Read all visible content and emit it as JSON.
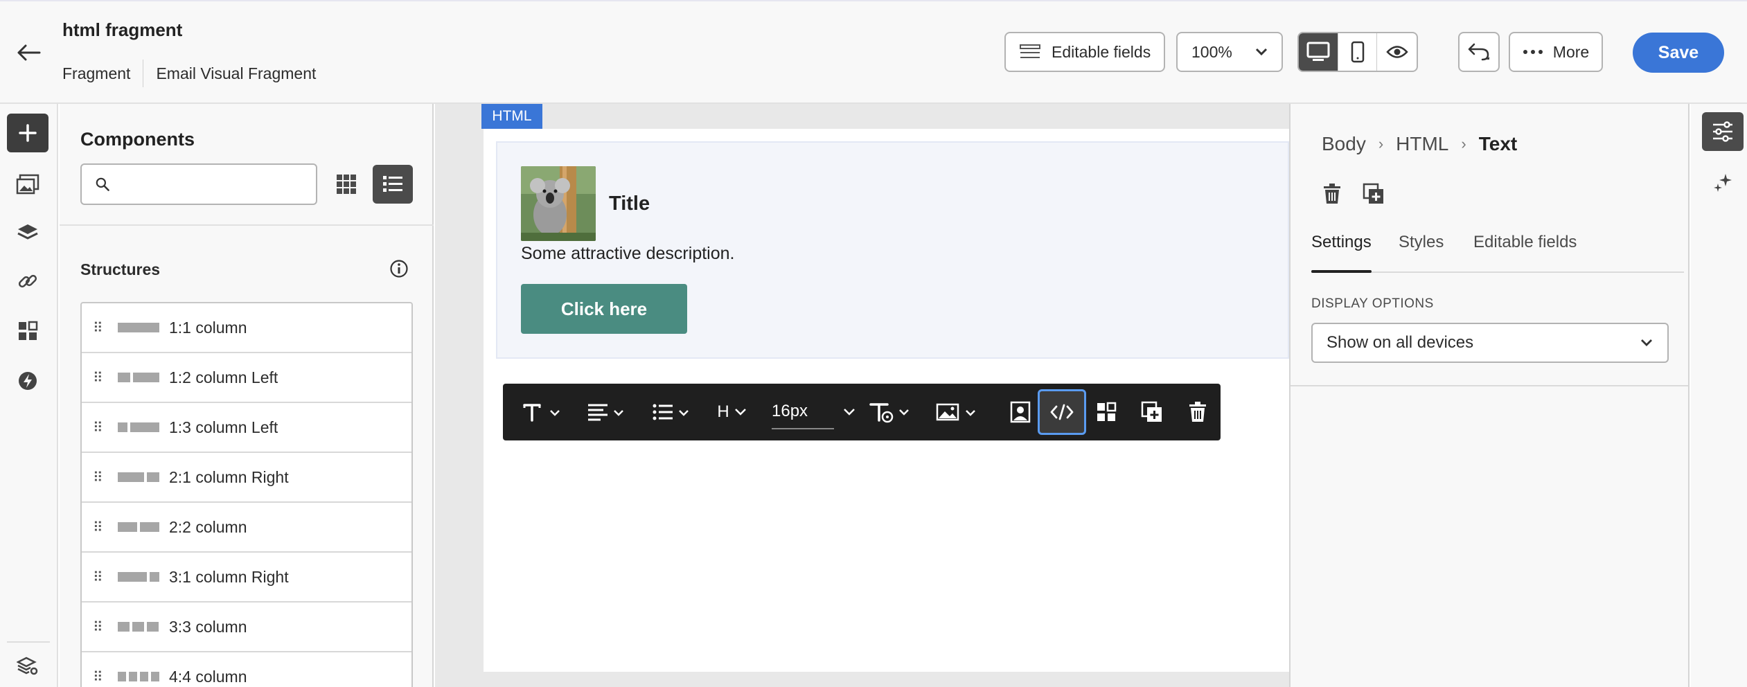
{
  "header": {
    "title": "html fragment",
    "breadcrumb": [
      "Fragment",
      "Email Visual Fragment"
    ],
    "editable_fields_label": "Editable fields",
    "zoom": "100%",
    "more_label": "More",
    "save_label": "Save"
  },
  "components": {
    "title": "Components",
    "search_placeholder": "",
    "structures_label": "Structures",
    "structures": [
      {
        "label": "1:1 column"
      },
      {
        "label": "1:2 column Left"
      },
      {
        "label": "1:3 column Left"
      },
      {
        "label": "2:1 column Right"
      },
      {
        "label": "2:2 column"
      },
      {
        "label": "3:1 column Right"
      },
      {
        "label": "3:3 column"
      },
      {
        "label": "4:4 column"
      }
    ]
  },
  "canvas": {
    "tag": "HTML",
    "block_title": "Title",
    "block_description": "Some attractive description.",
    "cta_label": "Click here",
    "font_size": "16px",
    "heading_label": "H"
  },
  "props": {
    "breadcrumb": [
      "Body",
      "HTML",
      "Text"
    ],
    "tabs": [
      "Settings",
      "Styles",
      "Editable fields"
    ],
    "active_tab": "Settings",
    "display_options_label": "DISPLAY OPTIONS",
    "display_options_value": "Show on all devices"
  },
  "colors": {
    "accent": "#3a76d7",
    "cta": "#4a8c81",
    "toolbar": "#1f1f1f"
  }
}
